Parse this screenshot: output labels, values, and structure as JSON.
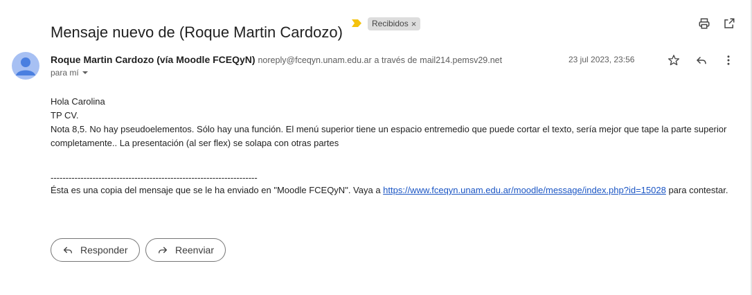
{
  "header": {
    "subject": "Mensaje nuevo de (Roque Martin Cardozo)",
    "label": "Recibidos",
    "label_remove": "×",
    "importance_color": "#f4c20d",
    "icons": [
      "print-icon",
      "open-in-new-window-icon"
    ]
  },
  "message": {
    "sender_name": "Roque Martin Cardozo (vía Moodle FCEQyN)",
    "sender_email": "noreply@fceqyn.unam.edu.ar",
    "via_text": "a través de",
    "via_domain": "mail214.pemsv29.net",
    "recipient": "para mí",
    "date": "23 jul 2023, 23:56",
    "icons": [
      "star-icon",
      "reply-icon",
      "more-vert-icon"
    ]
  },
  "body": {
    "lines": [
      "Hola Carolina",
      "TP CV.",
      "Nota 8,5. No hay pseudoelementos. Sólo hay una función. El menú superior tiene un espacio entremedio que puede cortar el texto, sería mejor que tape la parte superior completamente.. La presentación (al ser flex) se solapa con otras partes"
    ],
    "separator": "---------------------------------------------------------------------",
    "footer_prefix": "Ésta es una copia del mensaje que se le ha enviado en \"Moodle FCEQyN\". Vaya a ",
    "footer_link": "https://www.fceqyn.unam.edu.ar/moodle/message/index.php?id=15028",
    "footer_suffix": " para contestar."
  },
  "actions": {
    "reply_label": "Responder",
    "forward_label": "Reenviar"
  },
  "colors": {
    "link": "#1a55c4",
    "avatar_bg": "#a7c0f3",
    "avatar_fg": "#4a7fe0"
  }
}
